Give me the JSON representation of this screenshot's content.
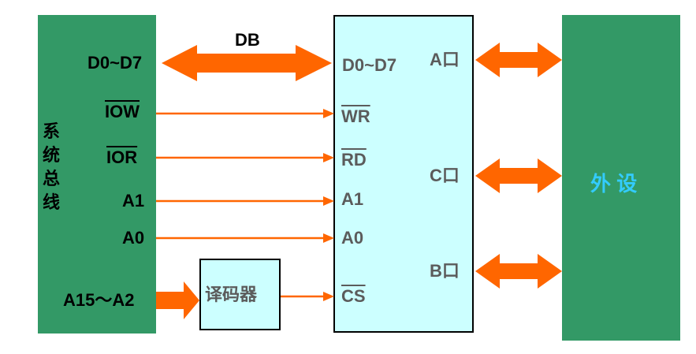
{
  "bus_label": "DB",
  "system_bus": {
    "title_chars": [
      "系",
      "统",
      "总",
      "线"
    ],
    "signals": [
      "D0~D7",
      "IOW",
      "IOR",
      "A1",
      "A0",
      "A15～A2"
    ]
  },
  "chip": {
    "pins": [
      "D0~D7",
      "WR",
      "RD",
      "A1",
      "A0",
      "CS"
    ],
    "ports": [
      "A口",
      "C口",
      "B口"
    ]
  },
  "decoder": {
    "label": "译码器"
  },
  "peripheral": {
    "label": "外 设"
  },
  "colors": {
    "bus_block": "#339966",
    "chip_fill": "#ccffff",
    "arrow": "#ff6600",
    "peripheral_text": "#33ccff"
  }
}
